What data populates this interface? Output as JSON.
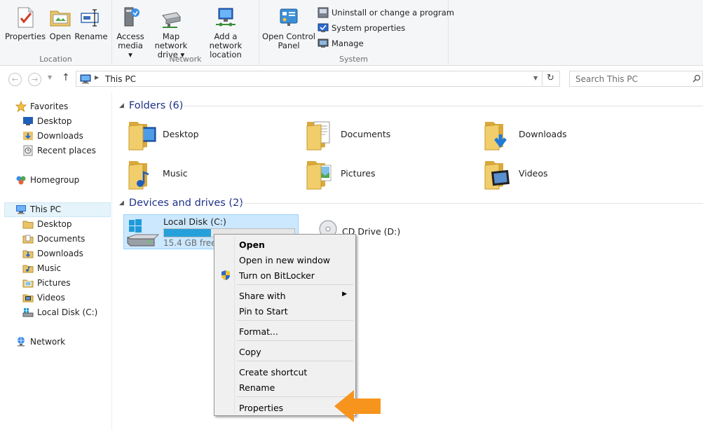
{
  "ribbon": {
    "location": {
      "group_label": "Location",
      "buttons": [
        {
          "label1": "Properties",
          "label2": "",
          "icon": "properties-icon"
        },
        {
          "label1": "Open",
          "label2": "",
          "icon": "open-icon"
        },
        {
          "label1": "Rename",
          "label2": "",
          "icon": "rename-icon"
        }
      ]
    },
    "network": {
      "group_label": "Network",
      "buttons": [
        {
          "label1": "Access",
          "label2": "media ▾",
          "icon": "access-media-icon"
        },
        {
          "label1": "Map network",
          "label2": "drive ▾",
          "icon": "map-network-drive-icon"
        },
        {
          "label1": "Add a network",
          "label2": "location",
          "icon": "add-network-location-icon"
        }
      ]
    },
    "system": {
      "group_label": "System",
      "open_control_panel": {
        "label1": "Open Control",
        "label2": "Panel",
        "icon": "control-panel-icon"
      },
      "small_buttons": [
        {
          "label": "Uninstall or change a program",
          "icon": "uninstall-icon"
        },
        {
          "label": "System properties",
          "icon": "system-properties-icon"
        },
        {
          "label": "Manage",
          "icon": "manage-icon"
        }
      ]
    }
  },
  "address": {
    "breadcrumb": "This PC",
    "search_placeholder": "Search This PC"
  },
  "navpane": {
    "favorites": {
      "label": "Favorites",
      "items": [
        "Desktop",
        "Downloads",
        "Recent places"
      ]
    },
    "homegroup": "Homegroup",
    "thispc": {
      "label": "This PC",
      "items": [
        "Desktop",
        "Documents",
        "Downloads",
        "Music",
        "Pictures",
        "Videos",
        "Local Disk (C:)"
      ]
    },
    "network": "Network"
  },
  "content": {
    "folders_header": "Folders (6)",
    "folders": [
      "Desktop",
      "Documents",
      "Downloads",
      "Music",
      "Pictures",
      "Videos"
    ],
    "devices_header": "Devices and drives (2)",
    "drive_c": {
      "label": "Local Disk (C:)",
      "free": "15.4 GB free o",
      "used_fraction": 0.36
    },
    "drive_d": {
      "label": "CD Drive (D:)"
    }
  },
  "context_menu": {
    "open": "Open",
    "open_new_window": "Open in new window",
    "bitlocker": "Turn on BitLocker",
    "share_with": "Share with",
    "pin_to_start": "Pin to Start",
    "format": "Format...",
    "copy": "Copy",
    "create_shortcut": "Create shortcut",
    "rename": "Rename",
    "properties": "Properties"
  },
  "colors": {
    "accent_arrow": "#f7941d",
    "selection_bg": "#cce8ff",
    "header_blue": "#1e3287"
  }
}
